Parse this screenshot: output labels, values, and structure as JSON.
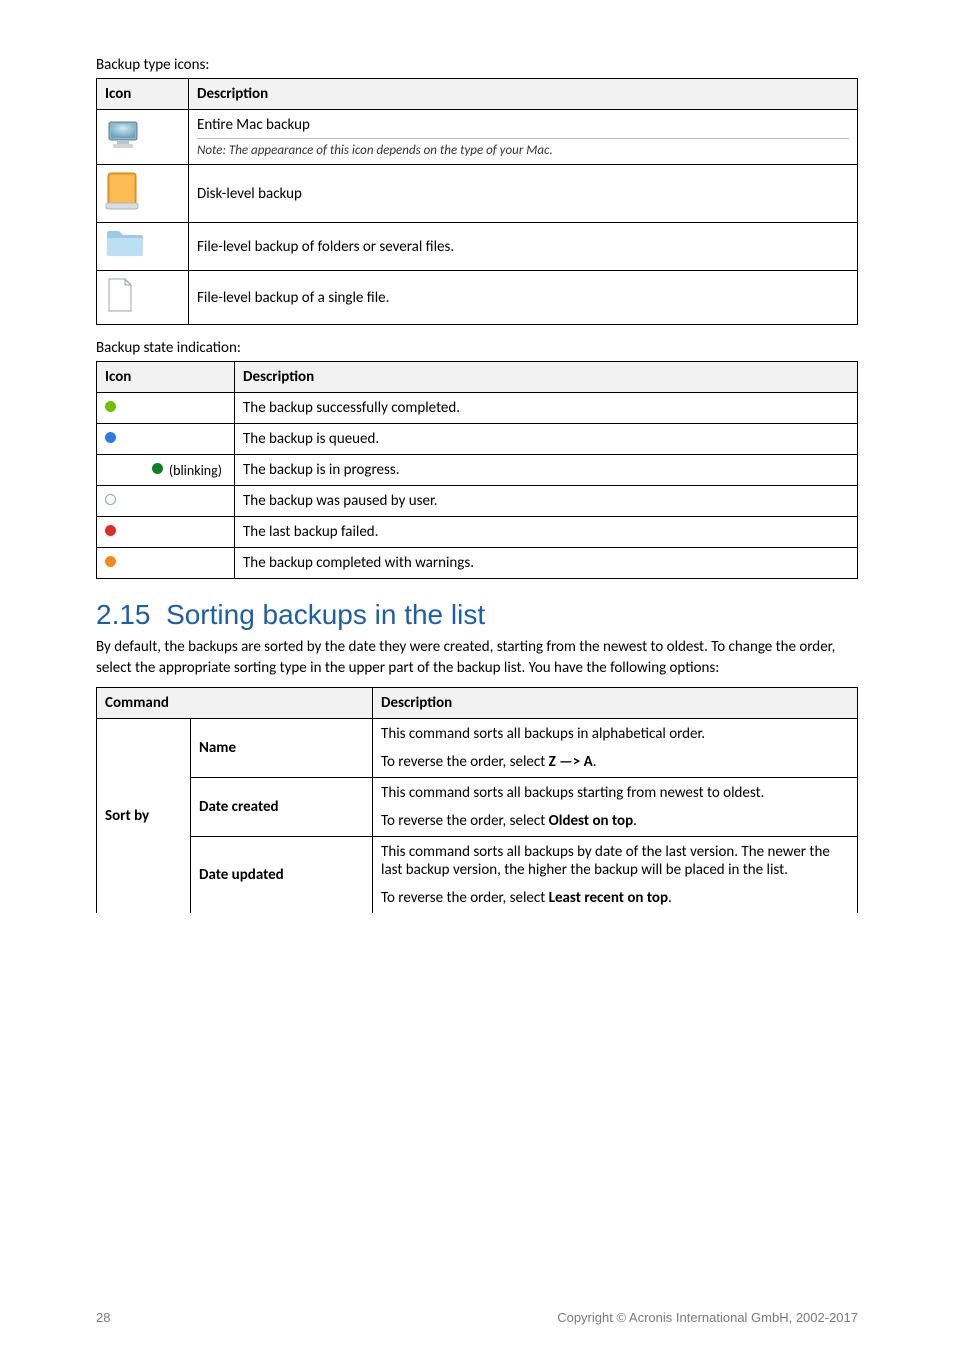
{
  "intro1": "Backup type icons:",
  "table1": {
    "headers": {
      "icon": "Icon",
      "desc": "Description"
    },
    "rows": [
      {
        "icon": "monitor-icon",
        "desc": "Entire Mac backup",
        "note": "Note: The appearance of this icon depends on the type of your Mac."
      },
      {
        "icon": "disk-icon",
        "desc": "Disk-level backup"
      },
      {
        "icon": "folder-icon",
        "desc": "File-level backup of folders or several files."
      },
      {
        "icon": "file-icon",
        "desc": "File-level backup of a single file."
      }
    ]
  },
  "intro2": "Backup state indication:",
  "table2": {
    "headers": {
      "icon": "Icon",
      "desc": "Description"
    },
    "blinking_label": "(blinking)",
    "rows": [
      {
        "dot": "lime",
        "desc": "The backup successfully completed."
      },
      {
        "dot": "blue",
        "desc": "The backup is queued."
      },
      {
        "dot": "green",
        "desc": "The backup is in progress.",
        "blinking": true
      },
      {
        "dot": "ring",
        "desc": "The backup was paused by user."
      },
      {
        "dot": "red",
        "desc": "The last backup failed."
      },
      {
        "dot": "orange",
        "desc": "The backup completed with warnings."
      }
    ]
  },
  "section": {
    "number": "2.15",
    "title": "Sorting backups in the list",
    "para": "By default, the backups are sorted by the date they were created, starting from the newest to oldest. To change the order, select the appropriate sorting type in the upper part of the backup list. You have the following options:"
  },
  "table3": {
    "headers": {
      "cmd": "Command",
      "desc": "Description"
    },
    "sortby_label": "Sort by",
    "rows": [
      {
        "name": "Name",
        "lines": {
          "a": "This command sorts all backups in alphabetical order.",
          "b_pre": "To reverse the order, select ",
          "b_bold": "Z —> A",
          "b_post": "."
        }
      },
      {
        "name": "Date created",
        "lines": {
          "a": "This command sorts all backups starting from newest to oldest.",
          "b_pre": "To reverse the order, select ",
          "b_bold": "Oldest on top",
          "b_post": "."
        }
      },
      {
        "name": "Date updated",
        "lines": {
          "a": "This command sorts all backups by date of the last version. The newer the last backup version, the higher the backup will be placed in the list.",
          "b_pre": "To reverse the order, select ",
          "b_bold": "Least recent on top",
          "b_post": "."
        }
      }
    ]
  },
  "footer": {
    "page": "28",
    "copyright": "Copyright © Acronis International GmbH, 2002-2017"
  }
}
